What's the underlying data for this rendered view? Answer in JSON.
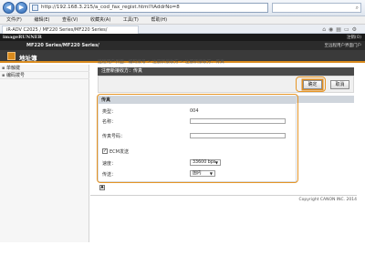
{
  "browser": {
    "url": "http://192.168.3.215/a_cod_fax_regist.html?iAddrNo=8",
    "menu": [
      "文件(F)",
      "编辑(E)",
      "查看(V)",
      "收藏夹(A)",
      "工具(T)",
      "帮助(H)"
    ],
    "tab_title": "iR-ADV C2025 / MF220 Series/MF220 Series/",
    "icons": [
      "home-icon",
      "rss-icon",
      "print-icon",
      "page-icon",
      "tools-icon"
    ]
  },
  "rui": {
    "brand": "imageRUNNER",
    "logout": "注销(O)",
    "model": "MF220 Series/MF220 Series/",
    "portal_link": "至远程用户界面门户",
    "page_title": "地址簿",
    "to_portal": "至远程用户界面门户"
  },
  "sidebar": {
    "items": [
      {
        "label": "单触键"
      },
      {
        "label": "编码拨号"
      }
    ]
  },
  "breadcrumb": "远程用户界面：编码拨号 > 注册新接收方 > 注册新接收方：传真",
  "panel_title": "注册新接收方：传真",
  "buttons": {
    "ok": "确定",
    "cancel": "取消"
  },
  "form": {
    "heading": "传真",
    "code_label": "类型：",
    "code_value": "004",
    "name_label": "名称：",
    "name_value": "",
    "fax_label": "传真号码：",
    "fax_value": "",
    "ecm_label": "ECM发送",
    "ecm_checked": "✓",
    "speed_label": "速度：",
    "speed_value": "33600 bps",
    "line_label": "传送：",
    "line_value": "国内"
  },
  "footer": {
    "copyright": "Copyright CANON INC. 2014"
  },
  "colors": {
    "accent": "#e59526",
    "header": "#3a3a3a"
  }
}
